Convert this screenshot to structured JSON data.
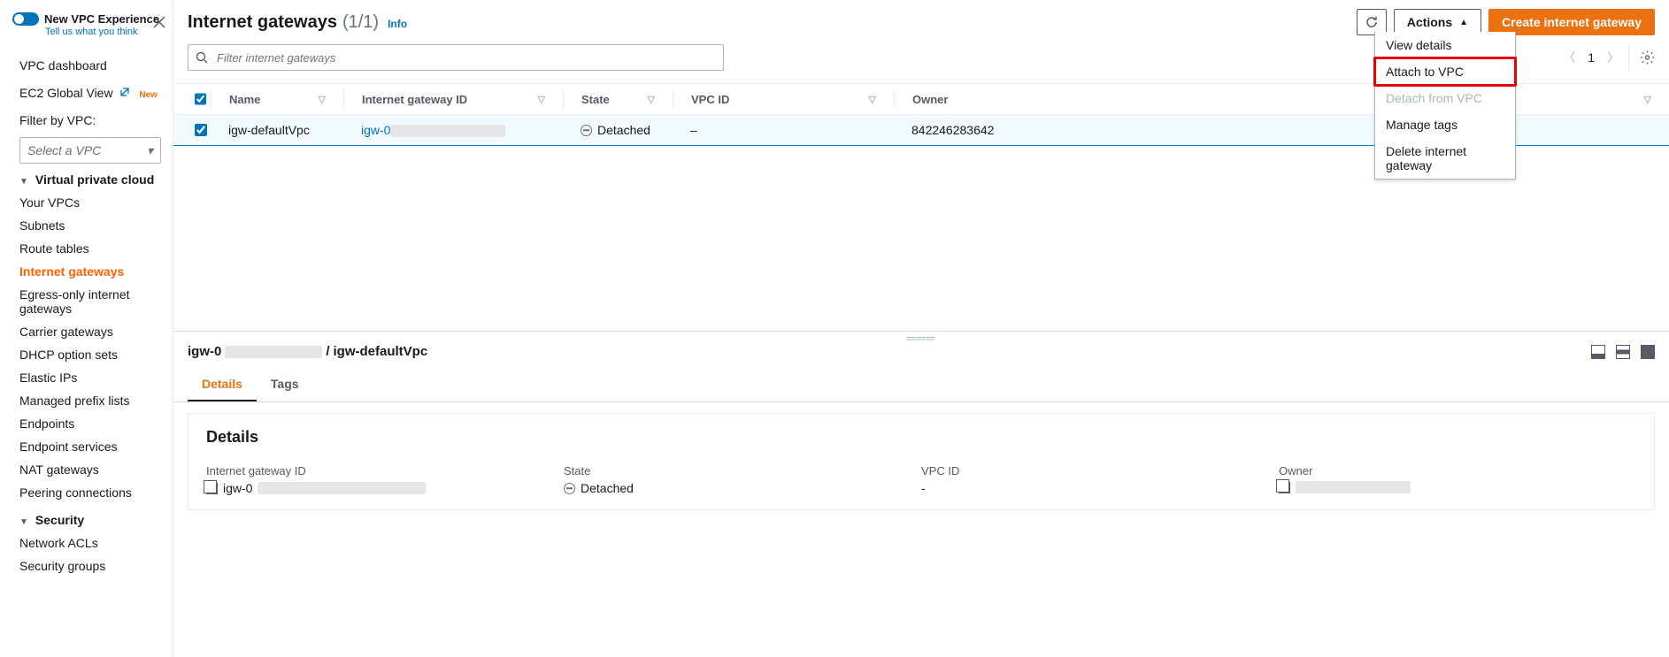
{
  "sidebar": {
    "experience_toggle_label": "New VPC Experience",
    "experience_sub": "Tell us what you think",
    "top_links": {
      "dashboard": "VPC dashboard",
      "ec2": "EC2 Global View",
      "ec2_badge": "New"
    },
    "filter_label": "Filter by VPC:",
    "select_placeholder": "Select a VPC",
    "sec_vpc": "Virtual private cloud",
    "vpc_items": [
      "Your VPCs",
      "Subnets",
      "Route tables",
      "Internet gateways",
      "Egress-only internet gateways",
      "Carrier gateways",
      "DHCP option sets",
      "Elastic IPs",
      "Managed prefix lists",
      "Endpoints",
      "Endpoint services",
      "NAT gateways",
      "Peering connections"
    ],
    "sec_security": "Security",
    "security_items": [
      "Network ACLs",
      "Security groups"
    ]
  },
  "header": {
    "title": "Internet gateways",
    "count": "(1/1)",
    "info": "Info",
    "actions_label": "Actions",
    "create_label": "Create internet gateway"
  },
  "search": {
    "placeholder": "Filter internet gateways"
  },
  "pager": {
    "page": "1"
  },
  "actions_menu": {
    "view": "View details",
    "attach": "Attach to VPC",
    "detach": "Detach from VPC",
    "tags": "Manage tags",
    "delete": "Delete internet gateway"
  },
  "table": {
    "cols": {
      "name": "Name",
      "igw": "Internet gateway ID",
      "state": "State",
      "vpc": "VPC ID",
      "owner": "Owner"
    },
    "row": {
      "name": "igw-defaultVpc",
      "igw_prefix": "igw-0",
      "state": "Detached",
      "vpc": "–",
      "owner": "842246283642"
    }
  },
  "detail": {
    "breadcrumb_prefix": "igw-0",
    "breadcrumb_sep": " / ",
    "breadcrumb_name": "igw-defaultVpc",
    "tabs": {
      "details": "Details",
      "tags": "Tags"
    },
    "card_title": "Details",
    "fields": {
      "igw_label": "Internet gateway ID",
      "igw_value": "igw-0",
      "state_label": "State",
      "state_value": "Detached",
      "vpc_label": "VPC ID",
      "vpc_value": "-",
      "owner_label": "Owner"
    }
  }
}
